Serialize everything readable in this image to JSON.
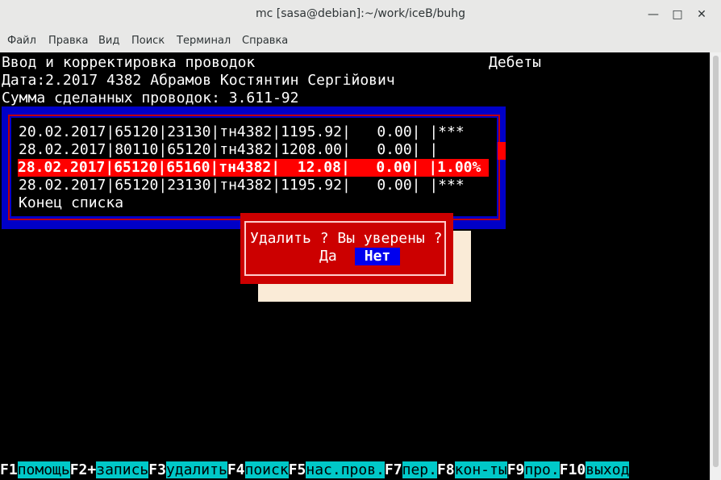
{
  "window": {
    "title": "mc [sasa@debian]:~/work/iceB/buhg"
  },
  "menu": [
    "Файл",
    "Правка",
    "Вид",
    "Поиск",
    "Терминал",
    "Справка"
  ],
  "header": {
    "line1_left": "Ввод и корректировка проводок",
    "line1_right": "Дебеты",
    "line2": "Дата:2.2017 4382 Абрамов Костянтин Сергійович",
    "line3": "Сумма сделанных проводок: 3.611-92"
  },
  "entries": [
    "20.02.2017|65120|23130|тн4382|1195.92|   0.00| |***",
    "28.02.2017|80110|65120|тн4382|1208.00|   0.00| |",
    "28.02.2017|65120|65160|тн4382|  12.08|   0.00| |1.00%",
    "28.02.2017|65120|23130|тн4382|1195.92|   0.00| |***"
  ],
  "list_end": "Конец списка",
  "dialog": {
    "question": "Удалить ? Вы уверены ?",
    "yes": "Да",
    "no": "Нет"
  },
  "fkeys": [
    {
      "key": "F1",
      "label": "помощь"
    },
    {
      "key": "F2+",
      "label": "запись"
    },
    {
      "key": "F3",
      "label": "удалить"
    },
    {
      "key": "F4",
      "label": "поиск"
    },
    {
      "key": "F5",
      "label": "нас.пров."
    },
    {
      "key": "F7",
      "label": "пер."
    },
    {
      "key": "F8",
      "label": "кон-ты"
    },
    {
      "key": "F9",
      "label": "про."
    },
    {
      "key": "F10",
      "label": "выход"
    }
  ],
  "colors": {
    "terminal_bg": "#000000",
    "frame_blue": "#0000c8",
    "selected_row": "#ff0000",
    "dialog_bg": "#cc0000",
    "fkey_label_bg": "#00c8c8"
  }
}
